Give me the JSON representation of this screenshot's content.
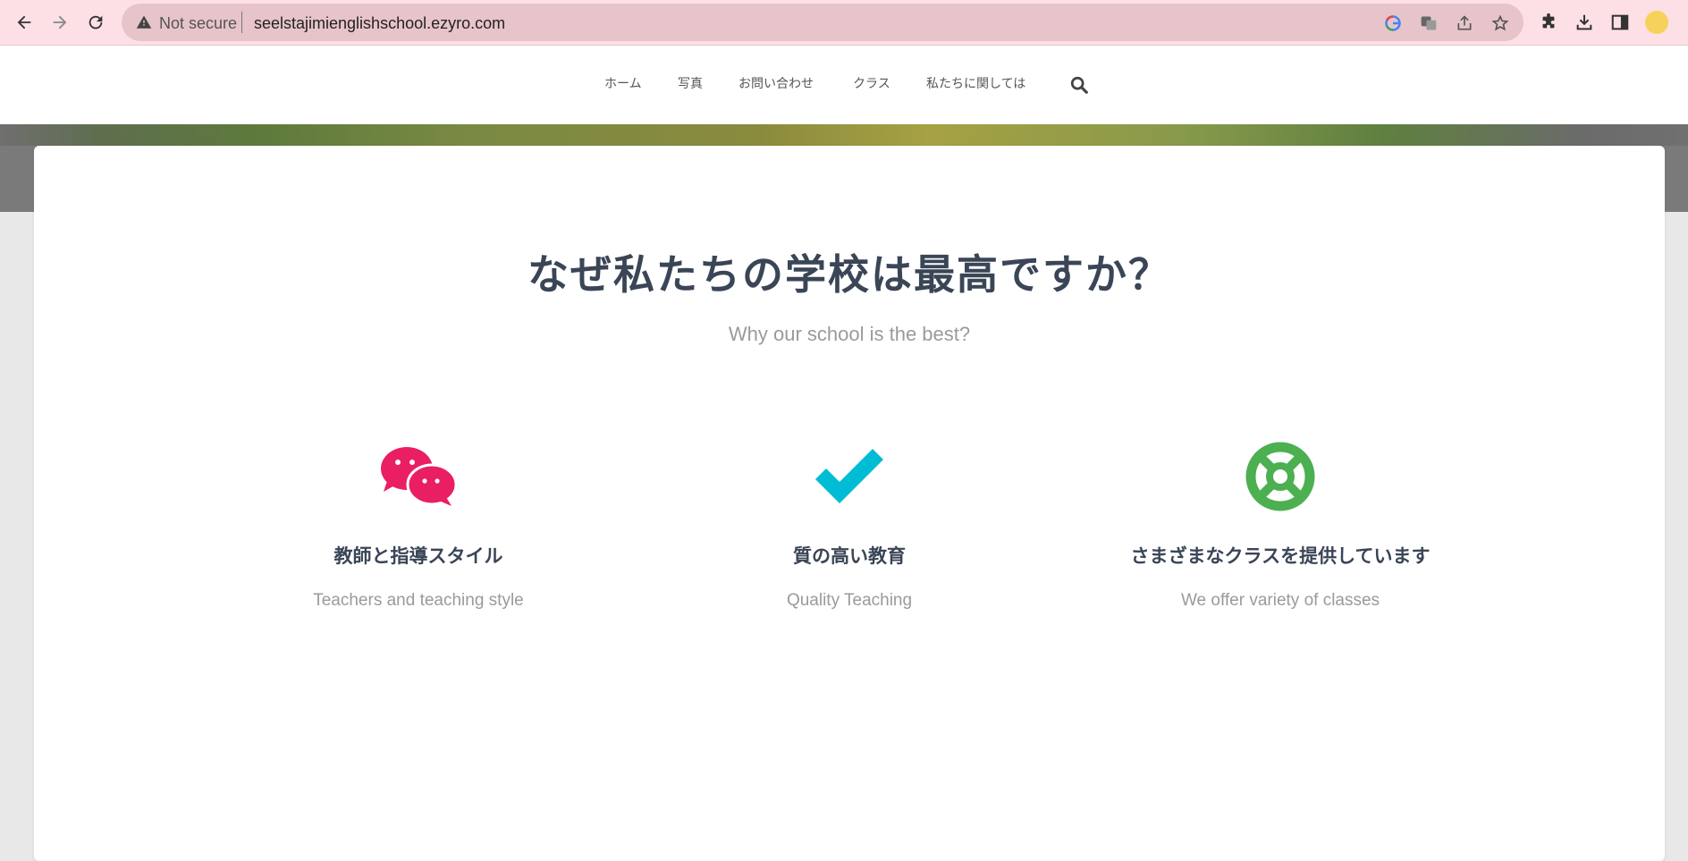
{
  "browser": {
    "security_label": "Not secure",
    "url": "seelstajimienglishschool.ezyro.com"
  },
  "nav": {
    "items": [
      "ホーム",
      "写真",
      "お問い合わせ",
      "クラス",
      "私たちに関しては"
    ]
  },
  "section": {
    "title": "なぜ私たちの学校は最高ですか？",
    "subtitle": "Why our school is the best?"
  },
  "features": [
    {
      "icon": "chat-bubbles-icon",
      "title": "教師と指導スタイル",
      "description": "Teachers and teaching style"
    },
    {
      "icon": "checkmark-icon",
      "title": "質の高い教育",
      "description": "Quality Teaching"
    },
    {
      "icon": "lifebuoy-icon",
      "title": "さまざまなクラスを提供しています",
      "description": "We offer variety of classes"
    }
  ],
  "colors": {
    "pink": "#e91e63",
    "cyan": "#00bcd4",
    "green": "#4caf50",
    "heading": "#3a4556"
  }
}
